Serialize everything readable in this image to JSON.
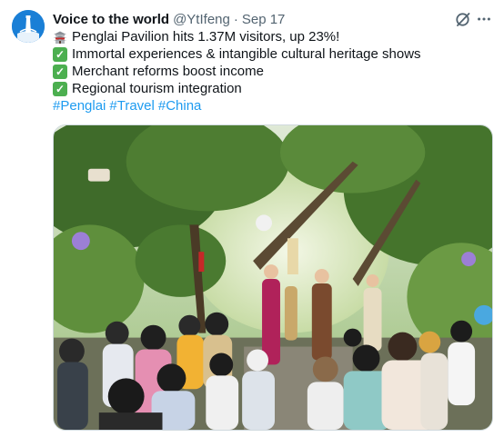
{
  "author": {
    "display_name": "Voice to the world",
    "handle": "@YtIfeng",
    "separator": "·",
    "timestamp": "Sep 17"
  },
  "tweet": {
    "lines": [
      {
        "icon": "pavilion-emoji",
        "text": "Penglai Pavilion hits 1.37M visitors, up 23%!"
      },
      {
        "icon": "check-mark-emoji",
        "text": "Immortal experiences & intangible cultural heritage shows"
      },
      {
        "icon": "check-mark-emoji",
        "text": "Merchant reforms boost income"
      },
      {
        "icon": "check-mark-emoji",
        "text": "Regional tourism integration"
      }
    ],
    "hashtags": [
      "#Penglai",
      "#Travel",
      "#China"
    ]
  },
  "icons": {
    "grok": "grok-icon",
    "more": "more-options-icon"
  },
  "colors": {
    "link": "#1d9bf0",
    "text": "#0f1419",
    "muted": "#536471",
    "avatar": "#1a7fd6"
  },
  "media": {
    "description_icon": "photo"
  }
}
